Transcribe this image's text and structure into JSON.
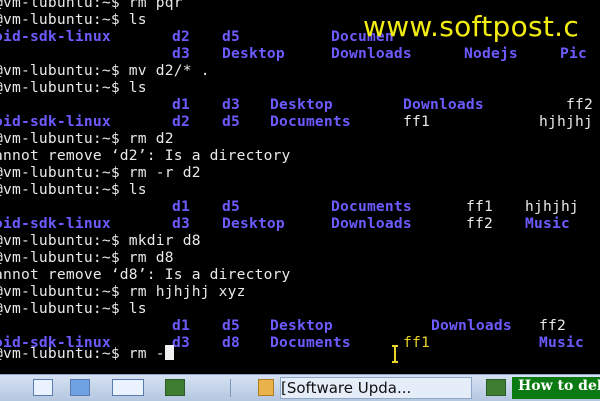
{
  "watermark": "www.softpost.c",
  "terminal": {
    "prompt_tail": "@vm-lubuntu:~$",
    "lines": [
      {
        "type": "cmd",
        "prefix": "@vm-lubuntu:~$",
        "text": " rm pqr"
      },
      {
        "type": "cmd",
        "prefix": "@vm-lubuntu:~$",
        "text": " ls"
      },
      {
        "type": "ls",
        "items": [
          "oid-sdk-linux",
          "d2",
          "d5",
          "Documen"
        ]
      },
      {
        "type": "ls",
        "items": [
          "d3",
          "Desktop",
          "Downloads",
          "Nodejs",
          "Pic"
        ]
      },
      {
        "type": "cmd",
        "prefix": "@vm-lubuntu:~$",
        "text": " mv d2/* ."
      },
      {
        "type": "cmd",
        "prefix": "@vm-lubuntu:~$",
        "text": " ls"
      },
      {
        "type": "ls",
        "items": [
          "d1",
          "d3",
          "Desktop",
          "Downloads",
          "ff2"
        ]
      },
      {
        "type": "ls",
        "items": [
          "oid-sdk-linux",
          "d2",
          "d5",
          "Documents",
          "ff1",
          "hjhjhj"
        ]
      },
      {
        "type": "cmd",
        "prefix": "@vm-lubuntu:~$",
        "text": " rm d2"
      },
      {
        "type": "out",
        "text": "annot remove ‘d2’: Is a directory"
      },
      {
        "type": "cmd",
        "prefix": "@vm-lubuntu:~$",
        "text": " rm -r d2"
      },
      {
        "type": "cmd",
        "prefix": "@vm-lubuntu:~$",
        "text": " ls"
      },
      {
        "type": "ls",
        "items": [
          "d1",
          "d5",
          "Documents",
          "ff1",
          "hjhjhj"
        ]
      },
      {
        "type": "ls",
        "items": [
          "oid-sdk-linux",
          "d3",
          "Desktop",
          "Downloads",
          "ff2",
          "Music"
        ]
      },
      {
        "type": "cmd",
        "prefix": "@vm-lubuntu:~$",
        "text": " mkdir d8"
      },
      {
        "type": "cmd",
        "prefix": "@vm-lubuntu:~$",
        "text": " rm d8"
      },
      {
        "type": "out",
        "text": "annot remove ‘d8’: Is a directory"
      },
      {
        "type": "cmd",
        "prefix": "@vm-lubuntu:~$",
        "text": " rm hjhjhj xyz"
      },
      {
        "type": "cmd",
        "prefix": "@vm-lubuntu:~$",
        "text": " ls"
      },
      {
        "type": "ls",
        "items": [
          "d1",
          "d5",
          "Desktop",
          "Downloads",
          "ff2"
        ]
      },
      {
        "type": "ls",
        "items": [
          "oid-sdk-linux",
          "d3",
          "d8",
          "Documents",
          "ff1",
          "Music"
        ]
      },
      {
        "type": "cmd",
        "prefix": "@vm-lubuntu:~$",
        "text": " rm -"
      }
    ]
  },
  "taskbar": {
    "window_button": "[Software Upda...",
    "video_label": "How to del"
  },
  "colors": {
    "background": "#000000",
    "text": "#e9e9e9",
    "directory": "#6c5bff",
    "watermark": "#f2ec12",
    "taskbar": "#c6d6ec",
    "video_banner": "#0b7a12"
  }
}
